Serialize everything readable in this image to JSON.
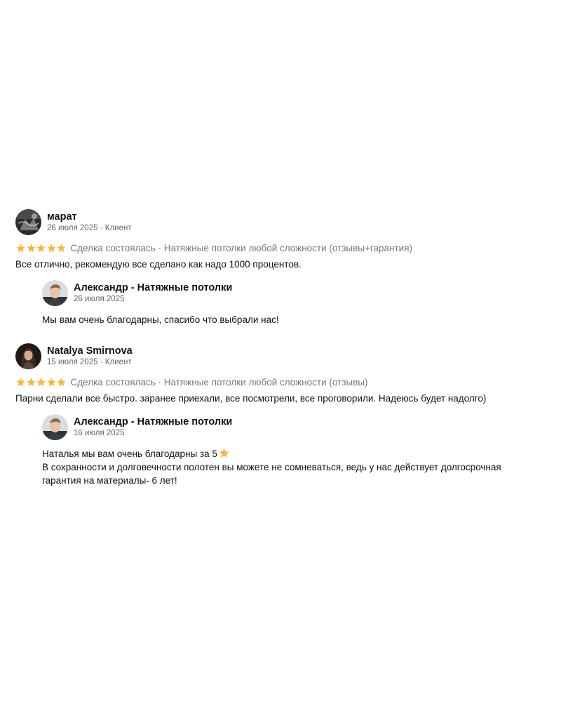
{
  "reviews": [
    {
      "author": "марат",
      "date": "26 июля 2025",
      "role": "Клиент",
      "avatar": "user-photo-avatar",
      "stars": 5,
      "deal_status": "Сделка состоялась",
      "company": "Натяжные потолки любой сложности (отзывы+гарантия)",
      "text": "Все отлично, рекомендую все сделано как надо 1000 процентов.",
      "reply": {
        "author": "Александр - Натяжные потолки",
        "date": "26 июля 2025",
        "avatar": "business-owner-photo-avatar",
        "lines": [
          "Мы вам очень благодарны, спасибо что выбрали нас!"
        ]
      }
    },
    {
      "author": "Natalya Smirnova",
      "date": "15 июля 2025",
      "role": "Клиент",
      "avatar": "user-photo-avatar",
      "stars": 5,
      "deal_status": "Сделка состоялась",
      "company": "Натяжные потолки любой сложности (отзывы)",
      "text": "Парни сделали все быстро. заранее приехали, все посмотрели, все проговорили. Надеюсь будет надолго)",
      "reply": {
        "author": "Александр - Натяжные потолки",
        "date": "16 июля 2025",
        "avatar": "business-owner-photo-avatar",
        "lines": [
          "Наталья мы вам очень благодарны за 5",
          "В сохранности и долговечности полотен вы можете не сомневаться, ведь у нас действует долгосрочная",
          "гарантия на материалы- 6 лет!"
        ]
      }
    }
  ],
  "separator": " · ",
  "colors": {
    "star": "#F6B93B",
    "meta": "#666666",
    "rating_text": "#777777",
    "text": "#111111"
  }
}
